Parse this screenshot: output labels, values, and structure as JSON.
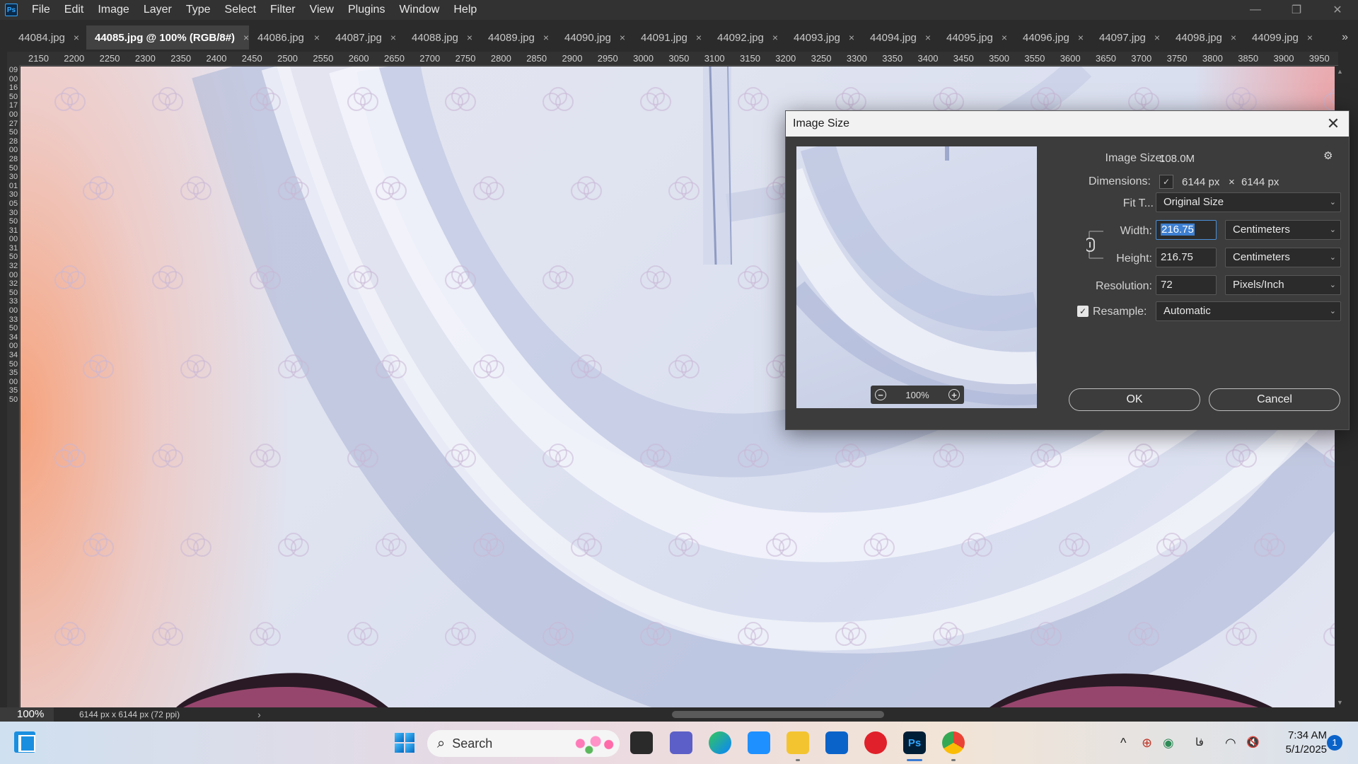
{
  "app": {
    "logo": "Ps",
    "menu": [
      "File",
      "Edit",
      "Image",
      "Layer",
      "Type",
      "Select",
      "Filter",
      "View",
      "Plugins",
      "Window",
      "Help"
    ],
    "window_controls": {
      "minimize": "—",
      "restore": "❐",
      "close": "✕"
    }
  },
  "tabs": [
    {
      "label": "44084.jpg",
      "active": false
    },
    {
      "label": "44085.jpg @ 100% (RGB/8#)",
      "active": true
    },
    {
      "label": "44086.jpg",
      "active": false
    },
    {
      "label": "44087.jpg",
      "active": false
    },
    {
      "label": "44088.jpg",
      "active": false
    },
    {
      "label": "44089.jpg",
      "active": false
    },
    {
      "label": "44090.jpg",
      "active": false
    },
    {
      "label": "44091.jpg",
      "active": false
    },
    {
      "label": "44092.jpg",
      "active": false
    },
    {
      "label": "44093.jpg",
      "active": false
    },
    {
      "label": "44094.jpg",
      "active": false
    },
    {
      "label": "44095.jpg",
      "active": false
    },
    {
      "label": "44096.jpg",
      "active": false
    },
    {
      "label": "44097.jpg",
      "active": false
    },
    {
      "label": "44098.jpg",
      "active": false
    },
    {
      "label": "44099.jpg",
      "active": false
    }
  ],
  "tab_close_glyph": "×",
  "tab_overflow": "»",
  "ruler": {
    "top_labels": [
      "2150",
      "2200",
      "2250",
      "2300",
      "2350",
      "2400",
      "2450",
      "2500",
      "2550",
      "2600",
      "2650",
      "2700",
      "2750",
      "2800",
      "2850",
      "2900",
      "2950",
      "3000",
      "3050",
      "3100",
      "3150",
      "3200",
      "3250",
      "3300",
      "3350",
      "3400",
      "3450",
      "3500",
      "3550",
      "3600",
      "3650",
      "3700",
      "3750",
      "3800",
      "3850",
      "3900",
      "3950"
    ],
    "left_labels": "0900165017002750280028503001300530503100315032003250330033503400345035003550"
  },
  "status": {
    "zoom": "100%",
    "doc_info": "6144 px x 6144 px (72 ppi)",
    "arrow": "›"
  },
  "dialog": {
    "title": "Image Size",
    "close": "✕",
    "preview_zoom": "100%",
    "preview_zoom_out": "−",
    "preview_zoom_in": "+",
    "gear_icon": "⚙",
    "image_size_label": "Image Size:",
    "image_size_value": "108.0M",
    "dimensions_label": "Dimensions:",
    "dimensions_check": "✓",
    "dimensions_width": "6144 px",
    "dimensions_x": "×",
    "dimensions_height": "6144 px",
    "fit_label": "Fit T...",
    "fit_value": "Original Size",
    "width_label": "Width:",
    "width_value": "216.75",
    "width_unit": "Centimeters",
    "height_label": "Height:",
    "height_value": "216.75",
    "height_unit": "Centimeters",
    "resolution_label": "Resolution:",
    "resolution_value": "72",
    "resolution_unit": "Pixels/Inch",
    "resample_check": "✓",
    "resample_label": "Resample:",
    "resample_value": "Automatic",
    "ok_label": "OK",
    "cancel_label": "Cancel",
    "chevron": "⌄"
  },
  "taskbar": {
    "search_placeholder": "Search",
    "search_icon": "⌕",
    "tray_chevron": "^",
    "lang": "فا",
    "wifi": "◠",
    "volume": "🔇",
    "time": "7:34 AM",
    "date": "5/1/2025",
    "notifications": "1",
    "ps_label": "Ps"
  },
  "colors": {
    "accent": "#31a8ff",
    "selection": "#3d7fd1",
    "dialog_bg": "#3c3c3c",
    "taskbar_ps": "#001e36"
  }
}
